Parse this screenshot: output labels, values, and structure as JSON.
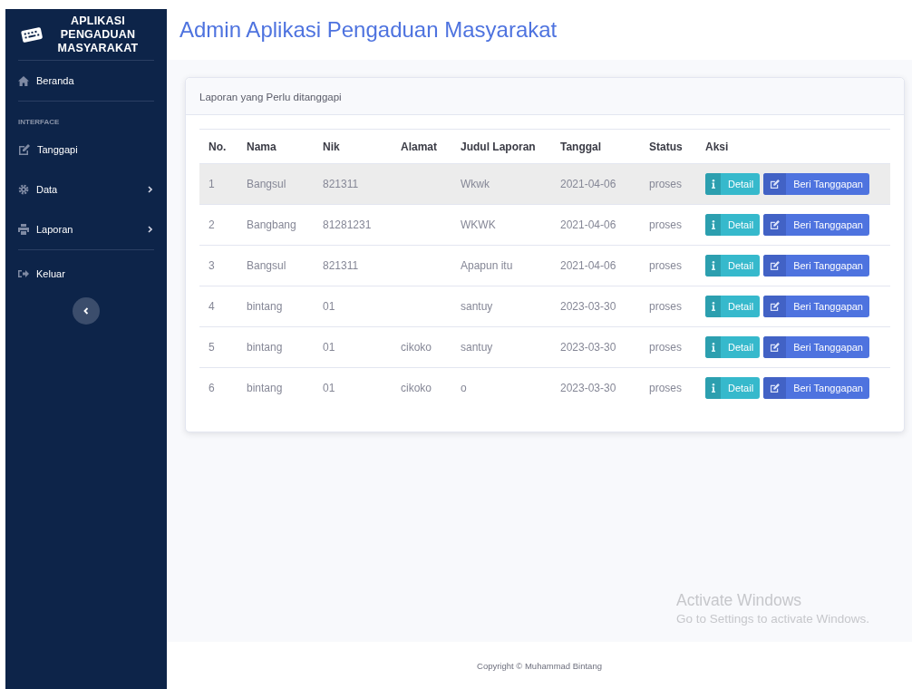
{
  "brand": {
    "title": "APLIKASI PENGADUAN MASYARAKAT"
  },
  "sidebar": {
    "items": [
      {
        "kind": "link",
        "label": "Beranda",
        "has_submenu": false,
        "divider_after": true
      },
      {
        "kind": "heading",
        "label": "INTERFACE"
      },
      {
        "kind": "link",
        "label": "Tanggapi",
        "has_submenu": false,
        "divider_after": false
      },
      {
        "kind": "link",
        "label": "Data",
        "has_submenu": true,
        "divider_after": false
      },
      {
        "kind": "link",
        "label": "Laporan",
        "has_submenu": true,
        "divider_after": true
      },
      {
        "kind": "link",
        "label": "Keluar",
        "has_submenu": false,
        "divider_after": false
      }
    ]
  },
  "header": {
    "title": "Admin Aplikasi Pengaduan Masyarakat"
  },
  "card": {
    "title": "Laporan yang Perlu ditanggapi"
  },
  "table": {
    "columns": [
      "No.",
      "Nama",
      "Nik",
      "Alamat",
      "Judul Laporan",
      "Tanggal",
      "Status",
      "Aksi"
    ],
    "rows": [
      {
        "highlighted": true,
        "cells": [
          "1",
          "Bangsul",
          "821311",
          "",
          "Wkwk",
          "2021-04-06",
          "proses"
        ],
        "actions": [
          "Detail",
          "Beri Tanggapan"
        ]
      },
      {
        "highlighted": false,
        "cells": [
          "2",
          "Bangbang",
          "81281231",
          "",
          "WKWK",
          "2021-04-06",
          "proses"
        ],
        "actions": [
          "Detail",
          "Beri Tanggapan"
        ]
      },
      {
        "highlighted": false,
        "cells": [
          "3",
          "Bangsul",
          "821311",
          "",
          "Apapun itu",
          "2021-04-06",
          "proses"
        ],
        "actions": [
          "Detail",
          "Beri Tanggapan"
        ]
      },
      {
        "highlighted": false,
        "cells": [
          "4",
          "bintang",
          "01",
          "",
          "santuy",
          "2023-03-30",
          "proses"
        ],
        "actions": [
          "Detail",
          "Beri Tanggapan"
        ]
      },
      {
        "highlighted": false,
        "cells": [
          "5",
          "bintang",
          "01",
          "cikoko",
          "santuy",
          "2023-03-30",
          "proses"
        ],
        "actions": [
          "Detail",
          "Beri Tanggapan"
        ]
      },
      {
        "highlighted": false,
        "cells": [
          "6",
          "bintang",
          "01",
          "cikoko",
          "o",
          "2023-03-30",
          "proses"
        ],
        "actions": [
          "Detail",
          "Beri Tanggapan"
        ]
      }
    ]
  },
  "footer": {
    "text": "Copyright © Muhammad Bintang"
  },
  "os_notice": {
    "title": "Activate Windows",
    "text": "Go to Settings to activate Windows."
  }
}
